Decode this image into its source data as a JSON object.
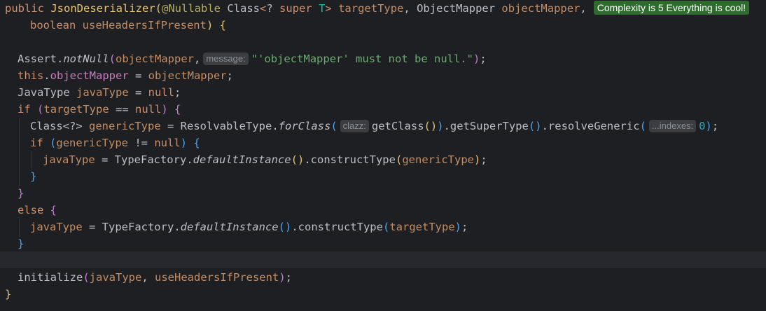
{
  "editor": {
    "complexity_badge": "Complexity is 5 Everything is cool!",
    "hints": {
      "message": "message:",
      "clazz": "clazz:",
      "indexes": "...indexes:"
    },
    "code": {
      "l1_public": "public",
      "l1_ctor": "JsonDeserializer",
      "l1_annotation": "@Nullable",
      "l1_class": "Class",
      "l1_wild": "?",
      "l1_super": "super",
      "l1_T": "T",
      "l1_targetType": "targetType",
      "l1_objectMapperType": "ObjectMapper",
      "l1_objectMapper": "objectMapper",
      "l2_boolean": "boolean",
      "l2_useHeaders": "useHeadersIfPresent",
      "l3_assert": "Assert",
      "l3_notNull": "notNull",
      "l3_objectMapper": "objectMapper",
      "l3_string": "\"'objectMapper' must not be null.\"",
      "l4_this": "this",
      "l4_field": "objectMapper",
      "l4_param": "objectMapper",
      "l5_javaTypeType": "JavaType",
      "l5_javaType": "javaType",
      "l5_null": "null",
      "l6_if": "if",
      "l6_targetType": "targetType",
      "l6_null": "null",
      "l7_class": "Class<?>",
      "l7_genericType": "genericType",
      "l7_resolvable": "ResolvableType",
      "l7_forClass": "forClass",
      "l7_getClass": "getClass",
      "l7_getSuperType": "getSuperType",
      "l7_resolveGeneric": "resolveGeneric",
      "l7_zero": "0",
      "l8_if": "if",
      "l8_genericType": "genericType",
      "l8_null": "null",
      "l9_javaType": "javaType",
      "l9_typeFactory": "TypeFactory",
      "l9_defaultInstance": "defaultInstance",
      "l9_constructType": "constructType",
      "l9_genericType": "genericType",
      "l12_else": "else",
      "l13_javaType": "javaType",
      "l13_typeFactory": "TypeFactory",
      "l13_defaultInstance": "defaultInstance",
      "l13_constructType": "constructType",
      "l13_targetType": "targetType",
      "l16_initialize": "initialize",
      "l16_javaType": "javaType",
      "l16_useHeaders": "useHeadersIfPresent"
    }
  },
  "colors": {
    "background": "#1e1f22",
    "keyword": "#cf8e6d",
    "method_call": "#56a8f5",
    "method_declaration": "#e8c46a",
    "field": "#c77dbb",
    "parameter": "#c48d63",
    "string": "#6aab73",
    "number": "#2aacb8",
    "badge": "#2f6b2e"
  }
}
